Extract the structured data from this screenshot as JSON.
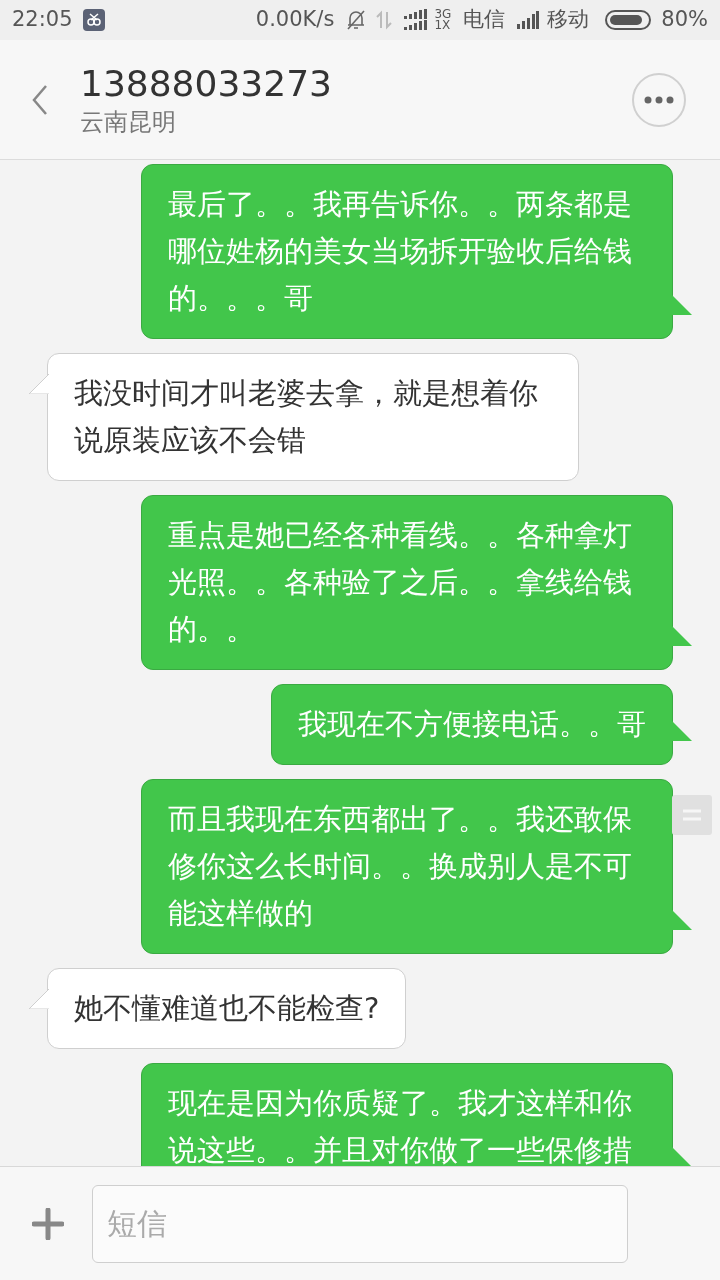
{
  "status_bar": {
    "time": "22:05",
    "speed": "0.00K/s",
    "network_type_top": "3G",
    "network_type_bottom": "1X",
    "carrier_1": "电信",
    "carrier_2": "移动",
    "battery_level": "80%"
  },
  "header": {
    "title": "13888033273",
    "subtitle": "云南昆明"
  },
  "messages": [
    {
      "kind": "sent",
      "text": "最后了。。我再告诉你。。两条都是哪位姓杨的美女当场拆开验收后给钱的。。。哥"
    },
    {
      "kind": "received",
      "text": "我没时间才叫老婆去拿，就是想着你说原装应该不会错"
    },
    {
      "kind": "sent",
      "text": "重点是她已经各种看线。。各种拿灯光照。。各种验了之后。。拿线给钱的。。"
    },
    {
      "kind": "sent",
      "text": "我现在不方便接电话。。哥"
    },
    {
      "kind": "sent",
      "text": "而且我现在东西都出了。。我还敢保修你这么长时间。。换成别人是不可能这样做的"
    },
    {
      "kind": "received",
      "text": "她不懂难道也不能检查?"
    },
    {
      "kind": "sent",
      "text": "现在是因为你质疑了。我才这样和你说这些。。并且对你做了一些保修措"
    }
  ],
  "composer": {
    "placeholder": "短信"
  }
}
